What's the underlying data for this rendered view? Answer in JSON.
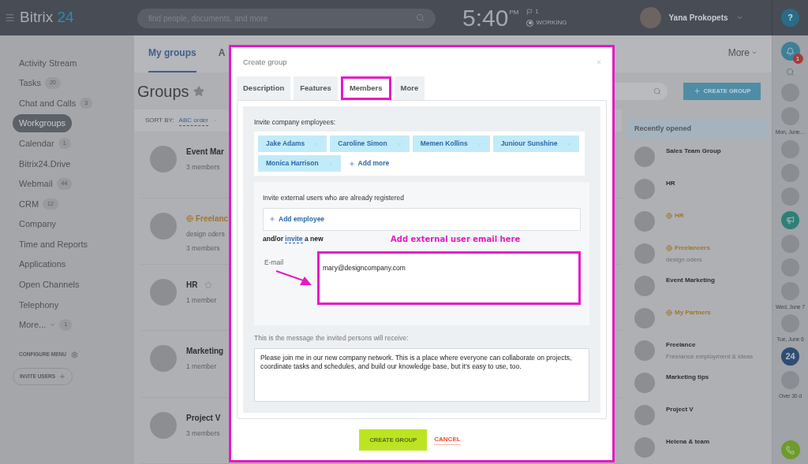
{
  "topbar": {
    "logo": "Bitrix",
    "logo_accent": "24",
    "search": {
      "placeholder": "find people, documents, and more"
    },
    "time": "5:40",
    "time_suffix": "PM",
    "flag_count": "1",
    "status": "WORKING",
    "user": "Yana Prokopets",
    "help": "?"
  },
  "sidebar": {
    "items": [
      {
        "label": "Activity Stream",
        "selected": false
      },
      {
        "label": "Tasks",
        "count": "20",
        "selected": false
      },
      {
        "label": "Chat and Calls",
        "count": "3",
        "selected": false
      },
      {
        "label": "Workgroups",
        "selected": true
      },
      {
        "label": "Calendar",
        "count": "1",
        "selected": false
      },
      {
        "label": "Bitrix24.Drive",
        "selected": false
      },
      {
        "label": "Webmail",
        "count": "44",
        "selected": false
      },
      {
        "label": "CRM",
        "count": "12",
        "selected": false
      },
      {
        "label": "Company",
        "selected": false
      },
      {
        "label": "Time and Reports",
        "selected": false
      },
      {
        "label": "Applications",
        "selected": false
      },
      {
        "label": "Open Channels",
        "selected": false
      },
      {
        "label": "Telephony",
        "selected": false
      },
      {
        "label": "More...",
        "count": "1",
        "selected": false,
        "dropdown": true
      }
    ],
    "configure": "CONFIGURE MENU",
    "invite": "INVITE USERS"
  },
  "main": {
    "tabs": [
      {
        "label": "My groups",
        "selected": true
      },
      {
        "label": "A",
        "selected": false
      }
    ],
    "more": "More",
    "title": "Groups",
    "sort_label": "SORT BY:",
    "sort_value": "ABC order",
    "create_button": "CREATE GROUP",
    "groups": [
      {
        "name": "Event Mar",
        "members": "3 members",
        "extranet": false,
        "star_icon": false
      },
      {
        "name": "Freelanc",
        "subtitle": "design oders",
        "members": "3 members",
        "extranet": true,
        "star_icon": false
      },
      {
        "name": "HR",
        "members": "1 member",
        "extranet": false,
        "star_icon": true
      },
      {
        "name": "Marketing",
        "members": "1 member",
        "extranet": false,
        "star_icon": false
      },
      {
        "name": "Project V",
        "members": "3 members",
        "extranet": false,
        "star_icon": false
      }
    ],
    "recent": {
      "title": "Recently opened",
      "items": [
        {
          "name": "Sales Team Group",
          "extranet": false
        },
        {
          "name": "HR",
          "extranet": false
        },
        {
          "name": "HR",
          "extranet": true
        },
        {
          "name": "Freelancers",
          "subtitle": "design oders",
          "extranet": true
        },
        {
          "name": "Event Marketing",
          "extranet": false
        },
        {
          "name": "My Partners",
          "extranet": true
        },
        {
          "name": "Freelance",
          "subtitle": "Freelance employment & ideas",
          "extranet": false
        },
        {
          "name": "Marketing tips",
          "extranet": false
        },
        {
          "name": "Project V",
          "extranet": false
        },
        {
          "name": "Helena & team",
          "extranet": false
        }
      ]
    }
  },
  "right_strip": {
    "notifications": "1",
    "items": [
      {
        "kind": "avatar"
      },
      {
        "kind": "avatar"
      },
      {
        "kind": "date",
        "label": "Mon, June…"
      },
      {
        "kind": "avatar"
      },
      {
        "kind": "avatar"
      },
      {
        "kind": "avatar"
      },
      {
        "kind": "megaphone"
      },
      {
        "kind": "avatar"
      },
      {
        "kind": "avatar"
      },
      {
        "kind": "avatar"
      },
      {
        "kind": "date",
        "label": "Wed, June 7"
      },
      {
        "kind": "avatar"
      },
      {
        "kind": "date",
        "label": "Tue, June 6"
      },
      {
        "kind": "logo",
        "label": "24"
      },
      {
        "kind": "avatar"
      },
      {
        "kind": "date",
        "label": "Over 30 d"
      }
    ]
  },
  "modal": {
    "title": "Create group",
    "tabs": [
      {
        "label": "Description",
        "selected": false
      },
      {
        "label": "Features",
        "selected": false
      },
      {
        "label": "Members",
        "selected": true
      },
      {
        "label": "More",
        "selected": false
      }
    ],
    "employees_label": "Invite company employees:",
    "employees": [
      "Jake Adams",
      "Caroline Simon",
      "Memen Kollins",
      "Juniour Sunshine",
      "Monica Harrison"
    ],
    "add_more": "Add more",
    "external_label": "Invite external users who are already registered",
    "add_employee": "Add employee",
    "invite_prefix": "and/or",
    "invite_link": "invite",
    "invite_suffix": "a new",
    "annotation": "Add external user email here",
    "email_label": "E-mail",
    "email_value": "mary@designcompany.com",
    "message_label": "This is the message the invited persons will receive:",
    "message": "Please join me in our new company network. This is a place where everyone can collaborate on projects, coordinate tasks and schedules, and build our knowledge base, but it's easy to use, too.",
    "create": "CREATE GROUP",
    "cancel": "CANCEL"
  }
}
